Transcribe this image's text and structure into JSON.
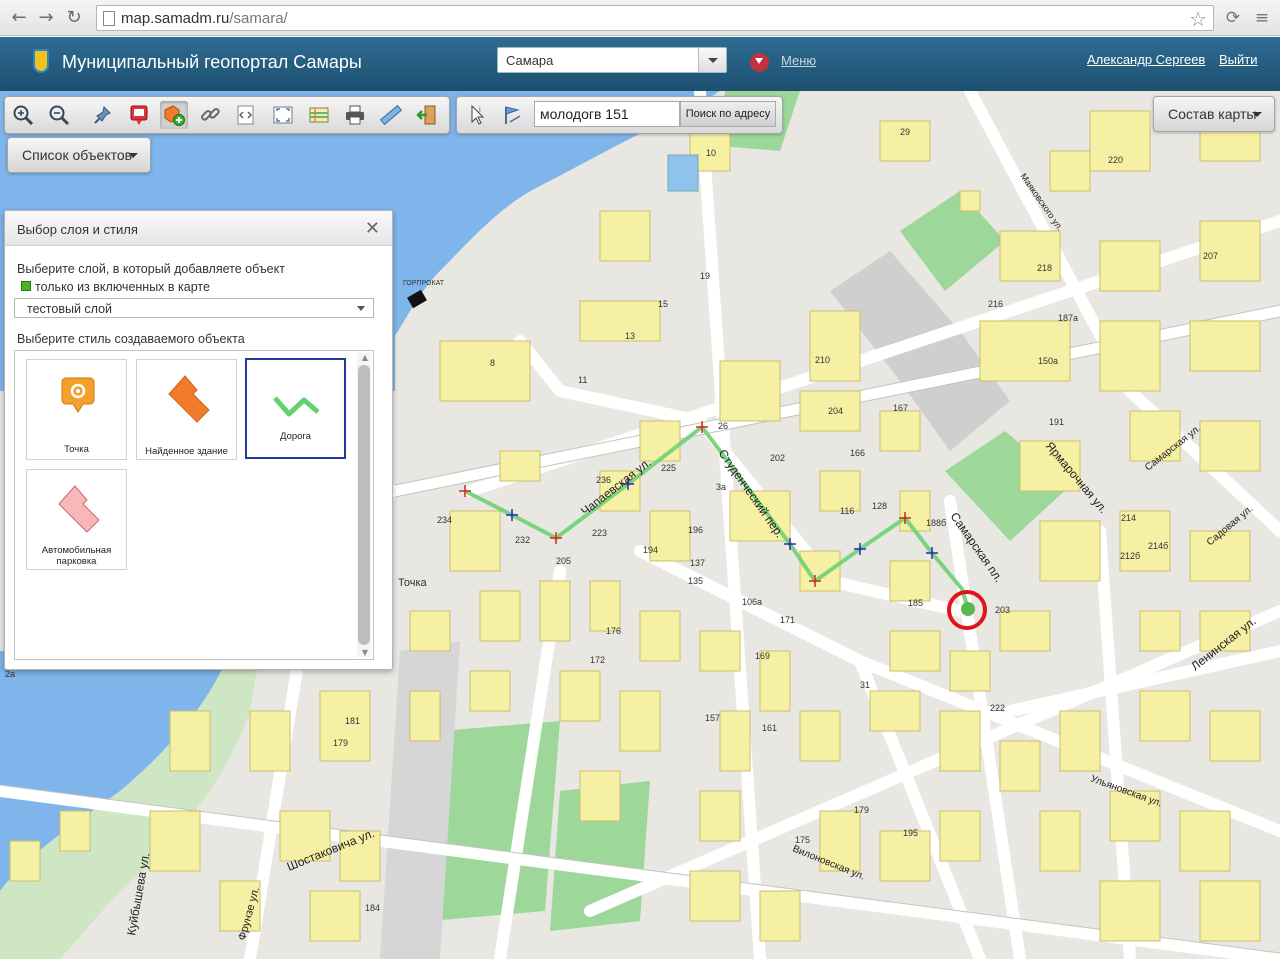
{
  "browser": {
    "url_host": "map.samadm.ru",
    "url_path": "/samara/"
  },
  "header": {
    "title": "Муниципальный геопортал Самары",
    "city_select": "Самара",
    "menu_label": "Меню",
    "user_name": "Александр Сергеев",
    "logout_label": "Выйти"
  },
  "toolbar": {
    "search_value": "молодогв 151",
    "search_button": "Поиск по адресу",
    "map_content_button": "Состав карты",
    "object_list_button": "Список объектов"
  },
  "panel": {
    "title": "Выбор слоя и стиля",
    "layer_prompt": "Выберите слой, в который добавляете объект",
    "only_enabled_label": "только из включенных в карте",
    "layer_value": "тестовый слой",
    "style_prompt": "Выберите стиль создаваемого объекта",
    "styles": [
      {
        "label": "Точка"
      },
      {
        "label": "Найденное здание"
      },
      {
        "label": "Дорога"
      },
      {
        "label": "Автомобильная парковка"
      }
    ]
  },
  "map": {
    "streets": [
      "Чапаевская ул.",
      "Студенческий пер.",
      "Самарская пл.",
      "Ярмарочная ул.",
      "Самарская ул.",
      "Садовая ул.",
      "Ленинская ул.",
      "Ульяновская ул.",
      "Вилоновская ул.",
      "Шостаковича ул.",
      "Фрунзе ул.",
      "Куйбышева ул.",
      "Маяковского ул."
    ],
    "place_labels": [
      "ГОРПРОКАТ",
      "Точка"
    ],
    "house_numbers": [
      "234",
      "223",
      "205",
      "232",
      "236",
      "225",
      "196",
      "194",
      "26",
      "3а",
      "202",
      "166",
      "116",
      "137",
      "135",
      "106а",
      "171",
      "167",
      "185",
      "188б",
      "128",
      "210",
      "204",
      "15",
      "13",
      "11",
      "8",
      "19",
      "10",
      "29",
      "220",
      "218",
      "216",
      "187а",
      "150а",
      "207",
      "191",
      "203",
      "212б",
      "214б",
      "214",
      "157",
      "161",
      "169",
      "181",
      "179",
      "176",
      "172",
      "175",
      "179",
      "184",
      "195",
      "2а",
      "31",
      "222"
    ]
  },
  "colors": {
    "building": "#f6f0a4",
    "building_stroke": "#c9bf69",
    "water": "#7fb5ea",
    "park": "#9ed79a",
    "road": "#ffffff",
    "route": "#6fd073",
    "highlight": "#e0141a",
    "header_bg": "#235a7e"
  }
}
